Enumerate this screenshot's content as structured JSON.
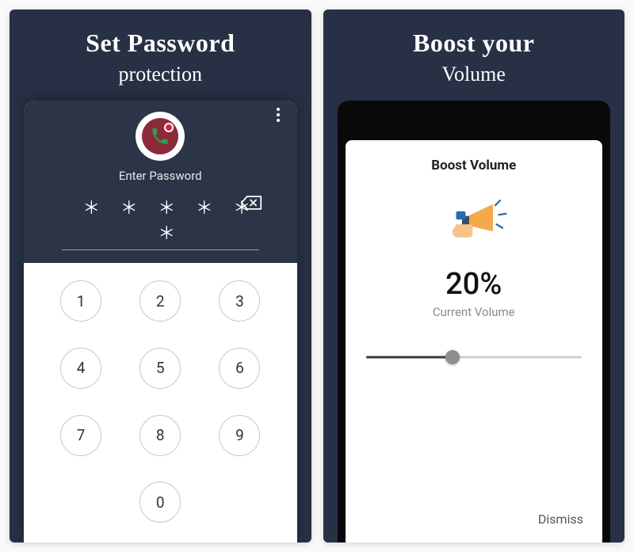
{
  "left": {
    "title_line1": "Set Password",
    "title_line2": "protection",
    "enter_label": "Enter Password",
    "password_mask": "＊ ＊ ＊ ＊ ＊ ＊",
    "keys": [
      "1",
      "2",
      "3",
      "4",
      "5",
      "6",
      "7",
      "8",
      "9",
      "",
      "0",
      ""
    ]
  },
  "right": {
    "title_line1": "Boost your",
    "title_line2": "Volume",
    "dialog_title": "Boost Volume",
    "volume_percent": "20%",
    "volume_caption": "Current Volume",
    "slider_value": 40,
    "dismiss_label": "Dismiss"
  },
  "colors": {
    "panel_bg": "#283045",
    "accent_blue": "#2a6bb0",
    "accent_orange": "#f6a94a"
  }
}
